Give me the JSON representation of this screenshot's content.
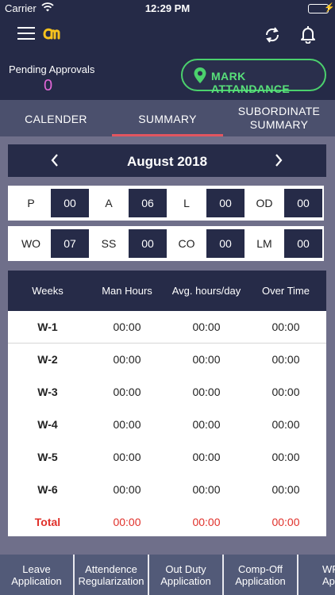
{
  "status_bar": {
    "carrier": "Carrier",
    "time": "12:29 PM"
  },
  "header": {
    "menu_icon": "hamburger-icon",
    "logo_icon": "cm-logo",
    "sync_icon": "sync-icon",
    "bell_icon": "bell-icon"
  },
  "pending": {
    "label": "Pending Approvals",
    "count": "0"
  },
  "mark_attendance": {
    "label": "MARK ATTANDANCE",
    "icon": "location-pin-icon"
  },
  "tabs": [
    {
      "label": "CALENDER",
      "active": false
    },
    {
      "label": "SUMMARY",
      "active": true
    },
    {
      "line1": "SUBORDINATE",
      "line2": "SUMMARY",
      "active": false
    }
  ],
  "month": {
    "title": "August 2018"
  },
  "stats": {
    "row1": [
      {
        "label": "P",
        "value": "00"
      },
      {
        "label": "A",
        "value": "06"
      },
      {
        "label": "L",
        "value": "00"
      },
      {
        "label": "OD",
        "value": "00"
      }
    ],
    "row2": [
      {
        "label": "WO",
        "value": "07"
      },
      {
        "label": "SS",
        "value": "00"
      },
      {
        "label": "CO",
        "value": "00"
      },
      {
        "label": "LM",
        "value": "00"
      }
    ]
  },
  "table": {
    "headers": [
      "Weeks",
      "Man Hours",
      "Avg. hours/day",
      "Over Time"
    ],
    "rows": [
      [
        "W-1",
        "00:00",
        "00:00",
        "00:00"
      ],
      [
        "W-2",
        "00:00",
        "00:00",
        "00:00"
      ],
      [
        "W-3",
        "00:00",
        "00:00",
        "00:00"
      ],
      [
        "W-4",
        "00:00",
        "00:00",
        "00:00"
      ],
      [
        "W-5",
        "00:00",
        "00:00",
        "00:00"
      ],
      [
        "W-6",
        "00:00",
        "00:00",
        "00:00"
      ]
    ],
    "total": [
      "Total",
      "00:00",
      "00:00",
      "00:00"
    ]
  },
  "bottom_tabs": [
    {
      "line1": "Leave",
      "line2": "Application"
    },
    {
      "line1": "Attendence",
      "line2": "Regularization"
    },
    {
      "line1": "Out Duty",
      "line2": "Application"
    },
    {
      "line1": "Comp-Off",
      "line2": "Application"
    },
    {
      "line1": "WF",
      "line2": "Applic"
    }
  ],
  "colors": {
    "header_bg": "#252a47",
    "accent_green": "#4bd16d",
    "pending_count": "#e267d8",
    "tab_underline": "#e25560",
    "total_red": "#e0302a"
  }
}
